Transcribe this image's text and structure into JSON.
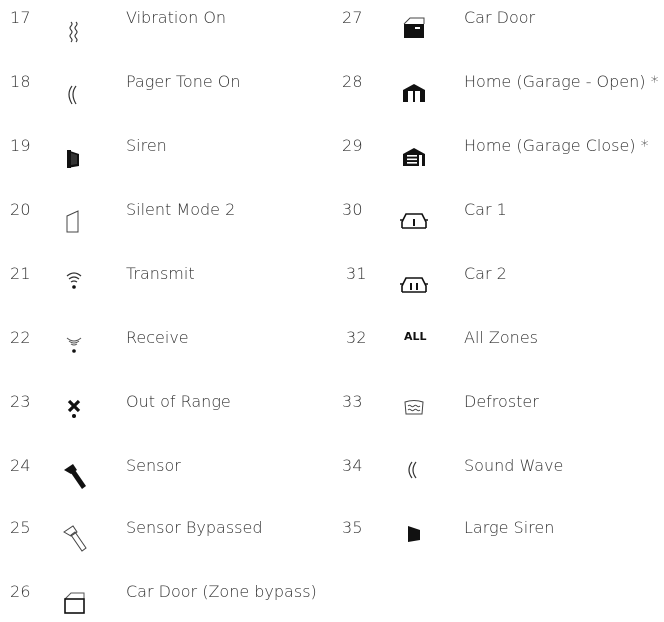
{
  "left": [
    {
      "num": "17",
      "label": "Vibration On",
      "icon": "vibration-icon"
    },
    {
      "num": "18",
      "label": "Pager Tone On",
      "icon": "pager-tone-icon"
    },
    {
      "num": "19",
      "label": "Siren",
      "icon": "siren-icon"
    },
    {
      "num": "20",
      "label": "Silent Mode 2",
      "icon": "silent-mode-icon"
    },
    {
      "num": "21",
      "label": "Transmit",
      "icon": "transmit-icon"
    },
    {
      "num": "22",
      "label": "Receive",
      "icon": "receive-icon"
    },
    {
      "num": "23",
      "label": "Out of Range",
      "icon": "out-of-range-icon"
    },
    {
      "num": "24",
      "label": "Sensor",
      "icon": "sensor-icon"
    },
    {
      "num": "25",
      "label": "Sensor Bypassed",
      "icon": "sensor-bypassed-icon"
    },
    {
      "num": "26",
      "label": "Car Door (Zone bypass)",
      "icon": "car-door-bypass-icon"
    }
  ],
  "right": [
    {
      "num": "27",
      "label": "Car Door",
      "icon": "car-door-icon"
    },
    {
      "num": "28",
      "label": "Home (Garage - Open) *",
      "icon": "garage-open-icon"
    },
    {
      "num": "29",
      "label": "Home (Garage Close) *",
      "icon": "garage-close-icon"
    },
    {
      "num": "30",
      "label": "Car 1",
      "icon": "car-1-icon"
    },
    {
      "num": "31",
      "label": "Car 2",
      "icon": "car-2-icon"
    },
    {
      "num": "32",
      "label": "All Zones",
      "icon": "all-zones-icon",
      "icon_text": "ALL"
    },
    {
      "num": "33",
      "label": "Defroster",
      "icon": "defroster-icon"
    },
    {
      "num": "34",
      "label": "Sound Wave",
      "icon": "sound-wave-icon"
    },
    {
      "num": "35",
      "label": "Large Siren",
      "icon": "large-siren-icon"
    }
  ]
}
